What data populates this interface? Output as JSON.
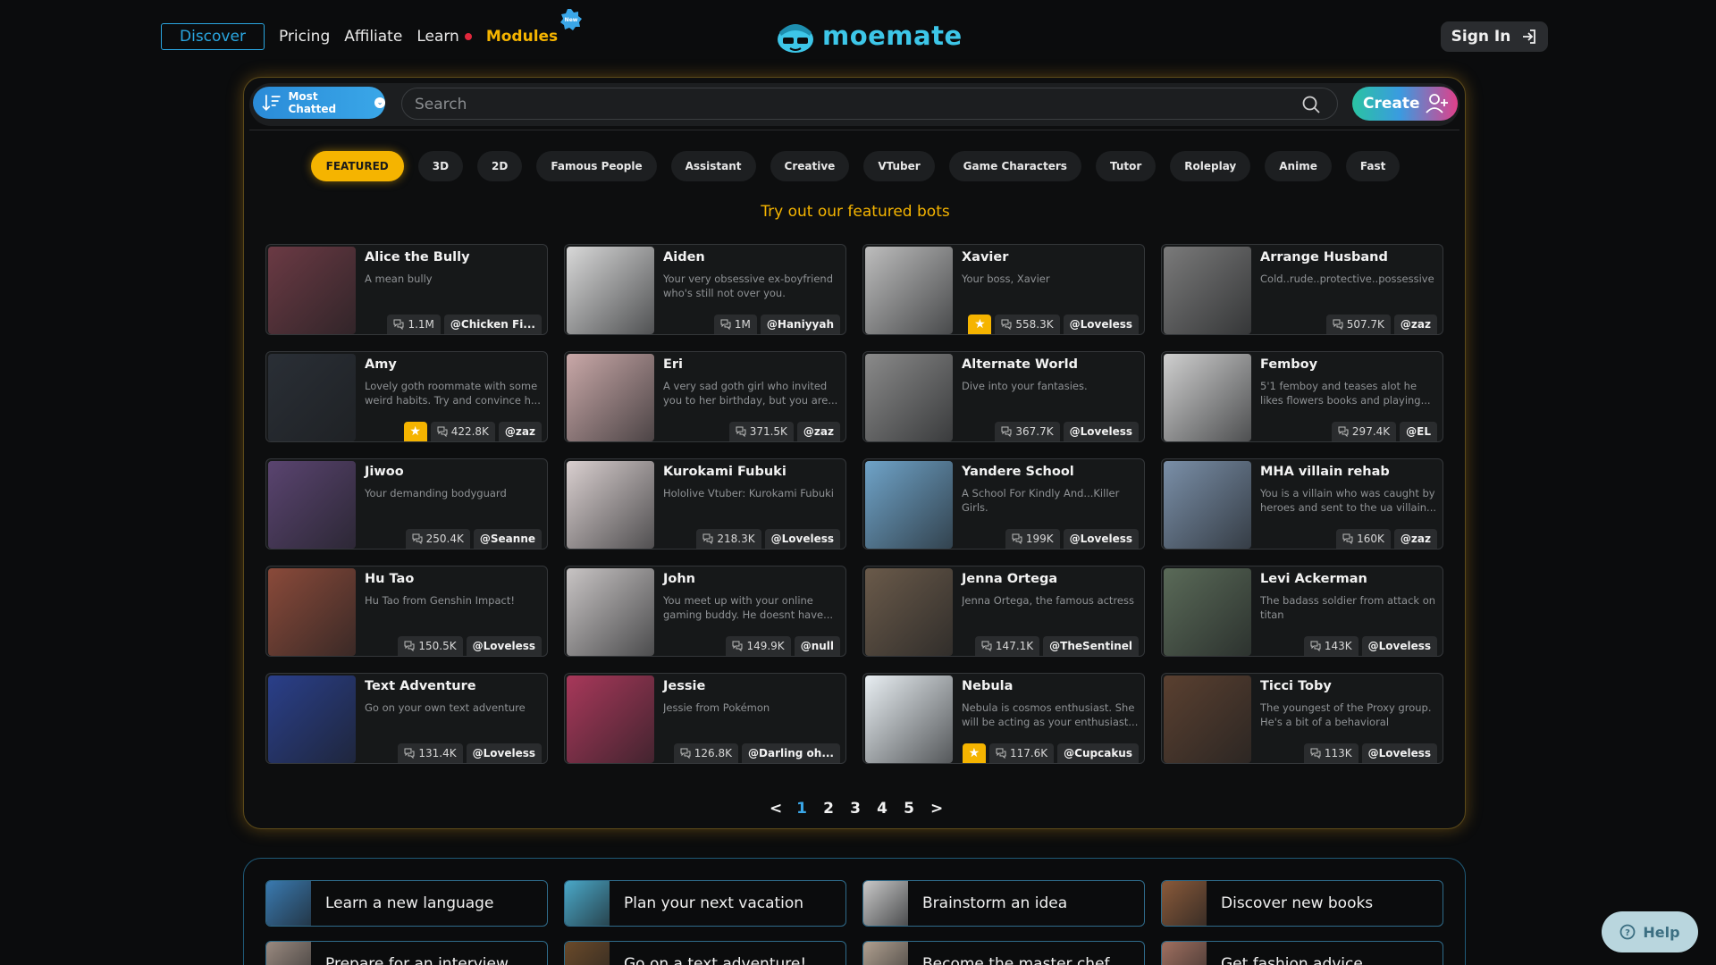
{
  "nav": {
    "discover": "Discover",
    "pricing": "Pricing",
    "affiliate": "Affiliate",
    "learn": "Learn",
    "modules": "Modules",
    "new_badge": "New",
    "logo_text": "moemate",
    "signin": "Sign In"
  },
  "toolbar": {
    "sort_label": "Most Chatted",
    "search_placeholder": "Search",
    "create_label": "Create"
  },
  "tabs": [
    "FEATURED",
    "3D",
    "2D",
    "Famous People",
    "Assistant",
    "Creative",
    "VTuber",
    "Game Characters",
    "Tutor",
    "Roleplay",
    "Anime",
    "Fast"
  ],
  "featured_title": "Try out our featured bots",
  "cards": [
    {
      "name": "Alice the Bully",
      "desc": "A mean bully",
      "count": "1.1M",
      "author": "@Chicken Fi...",
      "star": false,
      "color": "#6b3a44"
    },
    {
      "name": "Aiden",
      "desc": "Your very obsessive ex-boyfriend who's still not over you.",
      "count": "1M",
      "author": "@Haniyyah",
      "star": false,
      "color": "#d8d8d8"
    },
    {
      "name": "Xavier",
      "desc": "Your boss, Xavier",
      "count": "558.3K",
      "author": "@Loveless",
      "star": true,
      "color": "#bdbdbd"
    },
    {
      "name": "Arrange Husband",
      "desc": "Cold..rude..protective..possessive",
      "count": "507.7K",
      "author": "@zaz",
      "star": false,
      "color": "#7a7a7a"
    },
    {
      "name": "Amy",
      "desc": "Lovely goth roommate with some weird habits. Try and convince h...",
      "count": "422.8K",
      "author": "@zaz",
      "star": true,
      "color": "#2a2f36"
    },
    {
      "name": "Eri",
      "desc": "A very sad goth girl who invited you to her birthday, but you are...",
      "count": "371.5K",
      "author": "@zaz",
      "star": false,
      "color": "#c9a8a8"
    },
    {
      "name": "Alternate World",
      "desc": "Dive into your fantasies.",
      "count": "367.7K",
      "author": "@Loveless",
      "star": false,
      "color": "#8a8a8a"
    },
    {
      "name": "Femboy",
      "desc": "5'1 femboy and teases alot he likes flowers books and playing...",
      "count": "297.4K",
      "author": "@EL",
      "star": false,
      "color": "#cfcfcf"
    },
    {
      "name": "Jiwoo",
      "desc": "Your demanding bodyguard",
      "count": "250.4K",
      "author": "@Seanne",
      "star": false,
      "color": "#5a4470"
    },
    {
      "name": "Kurokami Fubuki",
      "desc": "Hololive Vtuber: Kurokami Fubuki",
      "count": "218.3K",
      "author": "@Loveless",
      "star": false,
      "color": "#d9cfcf"
    },
    {
      "name": "Yandere School",
      "desc": "A School For Kindly And...Killer Girls.",
      "count": "199K",
      "author": "@Loveless",
      "star": false,
      "color": "#6fa3c8"
    },
    {
      "name": "MHA villain rehab",
      "desc": "You is a villain who was caught by heroes and sent to the ua villain...",
      "count": "160K",
      "author": "@zaz",
      "star": false,
      "color": "#7a8fa8"
    },
    {
      "name": "Hu Tao",
      "desc": "Hu Tao from Genshin Impact!",
      "count": "150.5K",
      "author": "@Loveless",
      "star": false,
      "color": "#8a4a3a"
    },
    {
      "name": "John",
      "desc": "You meet up with your online gaming buddy. He doesnt have...",
      "count": "149.9K",
      "author": "@null",
      "star": false,
      "color": "#c8c4c4"
    },
    {
      "name": "Jenna Ortega",
      "desc": "Jenna Ortega, the famous actress",
      "count": "147.1K",
      "author": "@TheSentinel",
      "star": false,
      "color": "#6a5a4a"
    },
    {
      "name": "Levi Ackerman",
      "desc": "The badass soldier from attack on titan",
      "count": "143K",
      "author": "@Loveless",
      "star": false,
      "color": "#5a6a58"
    },
    {
      "name": "Text Adventure",
      "desc": "Go on your own text adventure",
      "count": "131.4K",
      "author": "@Loveless",
      "star": false,
      "color": "#2a3f8a"
    },
    {
      "name": "Jessie",
      "desc": "Jessie from Pokémon",
      "count": "126.8K",
      "author": "@Darling oh...",
      "star": false,
      "color": "#a8385a"
    },
    {
      "name": "Nebula",
      "desc": "Nebula is cosmos enthusiast. She will be acting as your enthusiast...",
      "count": "117.6K",
      "author": "@Cupcakus",
      "star": true,
      "color": "#e8eef2"
    },
    {
      "name": "Ticci Toby",
      "desc": "The youngest of the Proxy group. He's a bit of a behavioral anomal...",
      "count": "113K",
      "author": "@Loveless",
      "star": false,
      "color": "#5a4030"
    }
  ],
  "pager": {
    "prev": "<",
    "pages": [
      "1",
      "2",
      "3",
      "4",
      "5"
    ],
    "next": ">",
    "current": "1"
  },
  "suggestions": [
    {
      "label": "Learn a new language",
      "color": "#3a7ab0"
    },
    {
      "label": "Plan your next vacation",
      "color": "#4aa8c8"
    },
    {
      "label": "Brainstorm an idea",
      "color": "#c8c8c8"
    },
    {
      "label": "Discover new books",
      "color": "#8a5a3a"
    },
    {
      "label": "Prepare for an interview",
      "color": "#9a8a80"
    },
    {
      "label": "Go on a text adventure!",
      "color": "#6a4a2a"
    },
    {
      "label": "Become the master chef",
      "color": "#b0a090"
    },
    {
      "label": "Get fashion advice",
      "color": "#a07060"
    }
  ],
  "help_label": "Help",
  "colors": {
    "accent_gold": "#f5b400",
    "accent_blue": "#2aa6e0",
    "logo": "#3dc6e8"
  }
}
